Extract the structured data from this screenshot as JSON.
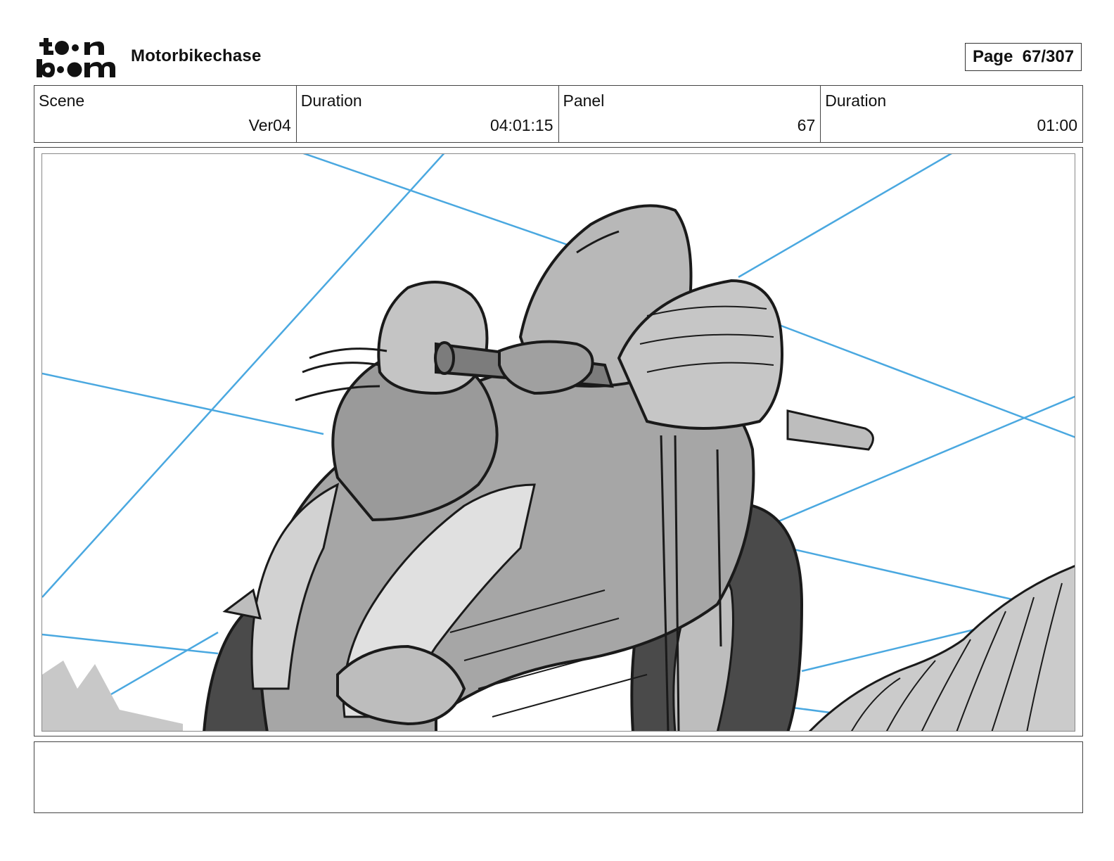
{
  "header": {
    "logo_text": "toon boom",
    "project_title": "Motorbikechase",
    "page_label": "Page",
    "page_number": "67/307"
  },
  "info": {
    "scene_label": "Scene",
    "scene_value": "Ver04",
    "scene_duration_label": "Duration",
    "scene_duration_value": "04:01:15",
    "panel_label": "Panel",
    "panel_value": "67",
    "panel_duration_label": "Duration",
    "panel_duration_value": "01:00"
  },
  "colors": {
    "guide_line": "#4aa8e0",
    "ink": "#1a1a1a",
    "shade_light": "#cfcfcf",
    "shade_mid": "#9e9e9e",
    "shade_dark": "#4a4a4a"
  },
  "caption": {
    "text": ""
  }
}
